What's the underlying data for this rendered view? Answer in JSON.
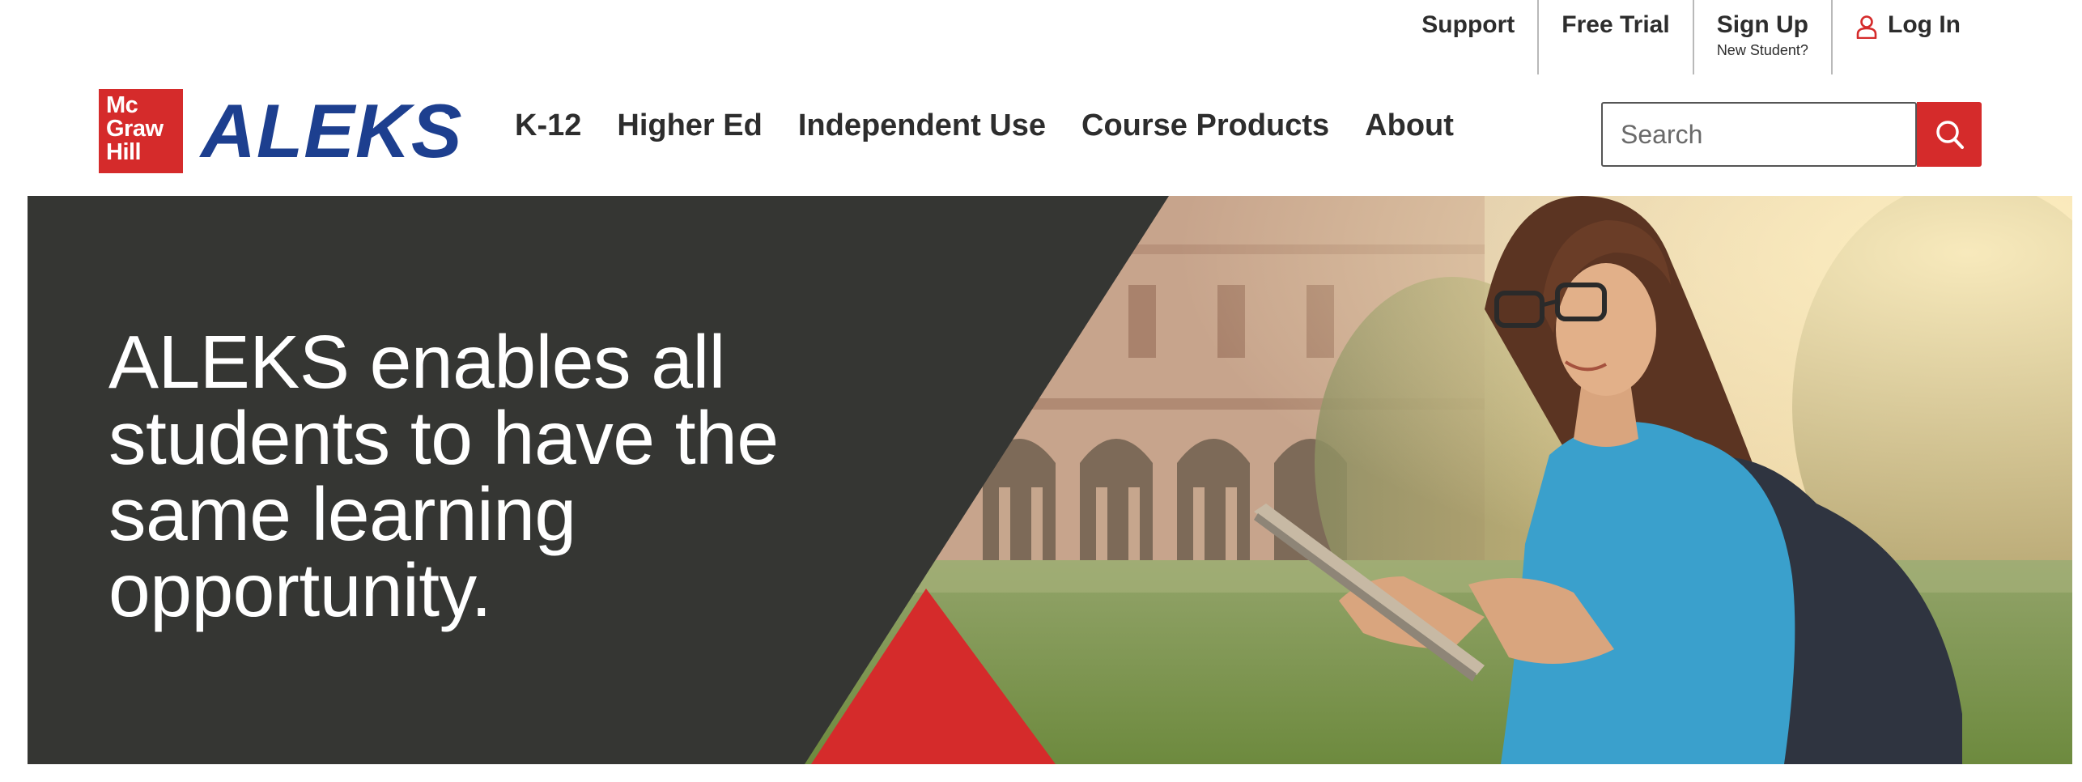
{
  "utility_nav": {
    "support": "Support",
    "free_trial": "Free Trial",
    "sign_up": "Sign Up",
    "sign_up_sub": "New Student?",
    "log_in": "Log In"
  },
  "logo": {
    "line1": "Mc",
    "line2": "Graw",
    "line3": "Hill",
    "product": "ALEKS",
    "registered": "®"
  },
  "main_nav": {
    "items": [
      "K-12",
      "Higher Ed",
      "Independent Use",
      "Course Products",
      "About"
    ]
  },
  "search": {
    "placeholder": "Search",
    "value": ""
  },
  "hero": {
    "headline": "ALEKS enables all students to have the same learning opportunity."
  },
  "icons": {
    "login": "person-icon",
    "search": "magnifier-icon"
  },
  "colors": {
    "brand_red": "#d52b2b",
    "brand_blue": "#1d3f8f",
    "hero_dark": "#3a3d3a",
    "text": "#2d2d2d"
  }
}
